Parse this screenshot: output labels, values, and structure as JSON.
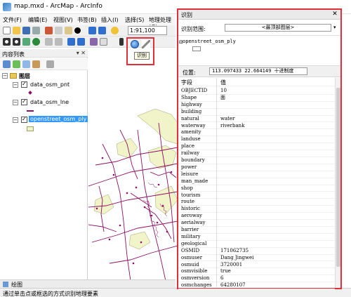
{
  "window": {
    "title": "map.mxd - ArcMap - ArcInfo"
  },
  "menu": [
    "文件(F)",
    "编辑(E)",
    "视图(V)",
    "书签(B)",
    "插入(I)",
    "选择(S)",
    "地理处理(G)"
  ],
  "toolbar": {
    "scale": "1:91,100",
    "identify_tooltip": "识别"
  },
  "toc": {
    "title": "内容列表",
    "pin": "▾ ✕",
    "root": "图层",
    "layers": [
      {
        "name": "data_osm_pnt",
        "symbol": "point"
      },
      {
        "name": "data_osm_lne",
        "symbol": "line"
      },
      {
        "name": "openstreet_osm_ply",
        "symbol": "polygon",
        "selected": true
      }
    ]
  },
  "bottom_tab": "绘图",
  "status": "通过单击点或框选的方式识别地理要素",
  "identify": {
    "title": "识别",
    "close": "✕",
    "from_label": "识别范围:",
    "from_value": "<最顶部图层>",
    "tree_node": "openstreet_osm_ply",
    "location_label": "位置:",
    "location_value": "113.097433  22.664149 十进制度",
    "col_field": "字段",
    "col_value": "值",
    "rows": [
      {
        "field": "OBJECTID",
        "value": "10"
      },
      {
        "field": "Shape",
        "value": "面"
      },
      {
        "field": "highway",
        "value": ""
      },
      {
        "field": "building",
        "value": ""
      },
      {
        "field": "natural",
        "value": "water"
      },
      {
        "field": "waterway",
        "value": "riverbank"
      },
      {
        "field": "amenity",
        "value": ""
      },
      {
        "field": "landuse",
        "value": ""
      },
      {
        "field": "place",
        "value": ""
      },
      {
        "field": "railway",
        "value": ""
      },
      {
        "field": "boundary",
        "value": ""
      },
      {
        "field": "power",
        "value": ""
      },
      {
        "field": "leisure",
        "value": ""
      },
      {
        "field": "man_made",
        "value": ""
      },
      {
        "field": "shop",
        "value": ""
      },
      {
        "field": "tourism",
        "value": ""
      },
      {
        "field": "route",
        "value": ""
      },
      {
        "field": "historic",
        "value": ""
      },
      {
        "field": "aeroway",
        "value": ""
      },
      {
        "field": "aerialway",
        "value": ""
      },
      {
        "field": "barrier",
        "value": ""
      },
      {
        "field": "military",
        "value": ""
      },
      {
        "field": "geological",
        "value": ""
      },
      {
        "field": "OSMID",
        "value": "171062735"
      },
      {
        "field": "osmuser",
        "value": "Dang Jingwei"
      },
      {
        "field": "osmuid",
        "value": "3720001"
      },
      {
        "field": "osmvisible",
        "value": "true"
      },
      {
        "field": "osmversion",
        "value": "6"
      },
      {
        "field": "osmchanges",
        "value": "64280107"
      }
    ]
  },
  "colors": {
    "highlight": "#e0303a",
    "map_line": "#8b1064",
    "map_fill": "#f1f3c8",
    "selection": "#3399ff"
  }
}
